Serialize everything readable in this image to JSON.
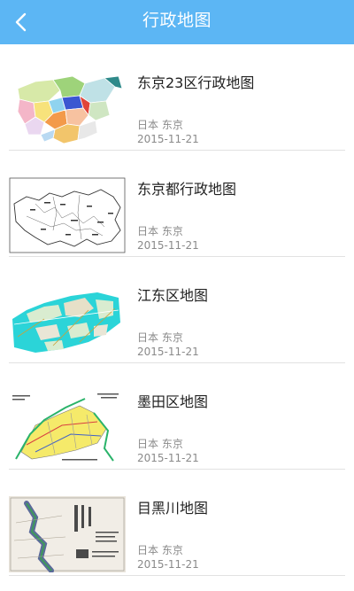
{
  "header": {
    "title": "行政地图",
    "back_icon": "chevron-left-icon",
    "background_color": "#5cb6f4"
  },
  "maps": [
    {
      "title": "东京23区行政地图",
      "location": "日本 东京",
      "date": "2015-11-21"
    },
    {
      "title": "东京都行政地图",
      "location": "日本 东京",
      "date": "2015-11-21"
    },
    {
      "title": "江东区地图",
      "location": "日本 东京",
      "date": "2015-11-21"
    },
    {
      "title": "墨田区地图",
      "location": "日本 东京",
      "date": "2015-11-21"
    },
    {
      "title": "目黑川地图",
      "location": "日本 东京",
      "date": "2015-11-21"
    }
  ]
}
